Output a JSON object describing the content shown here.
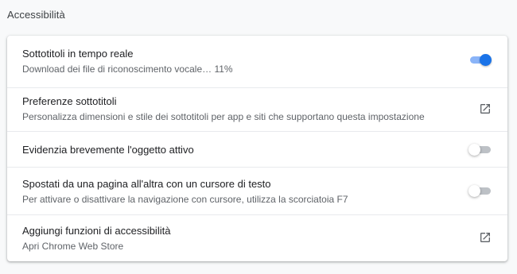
{
  "section": {
    "title": "Accessibilità"
  },
  "rows": [
    {
      "label": "Sottotitoli in tempo reale",
      "sublabel": "Download dei file di riconoscimento vocale… 11%",
      "control": "toggle",
      "checked": true
    },
    {
      "label": "Preferenze sottotitoli",
      "sublabel": "Personalizza dimensioni e stile dei sottotitoli per app e siti che supportano questa impostazione",
      "control": "external-link-icon"
    },
    {
      "label": "Evidenzia brevemente l'oggetto attivo",
      "control": "toggle",
      "checked": false
    },
    {
      "label": "Spostati da una pagina all'altra con un cursore di testo",
      "sublabel": "Per attivare o disattivare la navigazione con cursore, utilizza la scorciatoia F7",
      "control": "toggle",
      "checked": false
    },
    {
      "label": "Aggiungi funzioni di accessibilità",
      "sublabel": "Apri Chrome Web Store",
      "control": "external-link-icon"
    }
  ],
  "colors": {
    "accent": "#1a73e8",
    "accent_track": "#8ab4f8",
    "toggle_off_track": "#bdc1c6",
    "icon": "#5f6368"
  }
}
